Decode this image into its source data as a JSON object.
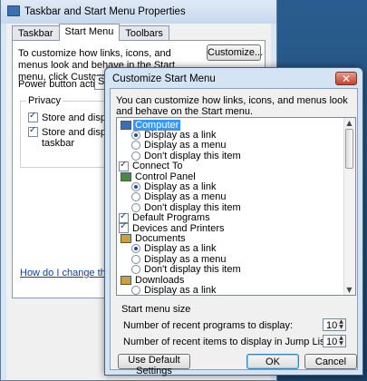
{
  "taskbar_window": {
    "title": "Taskbar and Start Menu Properties",
    "tabs": [
      {
        "label": "Taskbar"
      },
      {
        "label": "Start Menu"
      },
      {
        "label": "Toolbars"
      }
    ],
    "description": "To customize how links, icons, and menus look and behave in the Start menu, click Customize.",
    "customize_button": "Customize...",
    "power_button_label": "Power button action:",
    "power_button_value": "S",
    "privacy": {
      "legend": "Privacy",
      "items": [
        {
          "label": "Store and display re",
          "checked": true
        },
        {
          "label": "Store and display re",
          "label2": "taskbar",
          "checked": true
        }
      ]
    },
    "help_link": "How do I change the wa"
  },
  "customize_dialog": {
    "title": "Customize Start Menu",
    "close_glyph": "✕",
    "description": "You can customize how links, icons, and menus look and behave on the Start menu.",
    "items": [
      {
        "type": "header",
        "label": "Computer",
        "selected": true
      },
      {
        "type": "radio",
        "label": "Display as a link",
        "checked": true
      },
      {
        "type": "radio",
        "label": "Display as a menu",
        "checked": false
      },
      {
        "type": "radio",
        "label": "Don't display this item",
        "checked": false
      },
      {
        "type": "check",
        "label": "Connect To",
        "checked": true
      },
      {
        "type": "header",
        "label": "Control Panel"
      },
      {
        "type": "radio",
        "label": "Display as a link",
        "checked": true
      },
      {
        "type": "radio",
        "label": "Display as a menu",
        "checked": false
      },
      {
        "type": "radio",
        "label": "Don't display this item",
        "checked": false
      },
      {
        "type": "check",
        "label": "Default Programs",
        "checked": true
      },
      {
        "type": "check",
        "label": "Devices and Printers",
        "checked": true
      },
      {
        "type": "header",
        "label": "Documents"
      },
      {
        "type": "radio",
        "label": "Display as a link",
        "checked": true
      },
      {
        "type": "radio",
        "label": "Display as a menu",
        "checked": false
      },
      {
        "type": "radio",
        "label": "Don't display this item",
        "checked": false
      },
      {
        "type": "header",
        "label": "Downloads"
      },
      {
        "type": "radio",
        "label": "Display as a link",
        "checked": false
      }
    ],
    "start_menu_size": {
      "title": "Start menu size",
      "recent_programs_label": "Number of recent programs to display:",
      "recent_programs_value": "10",
      "jump_list_label": "Number of recent items to display in Jump Lists:",
      "jump_list_value": "10"
    },
    "buttons": {
      "defaults": "Use Default Settings",
      "ok": "OK",
      "cancel": "Cancel"
    },
    "colors": {
      "selection": "#3399ff",
      "close_button": "#c0442b"
    }
  }
}
